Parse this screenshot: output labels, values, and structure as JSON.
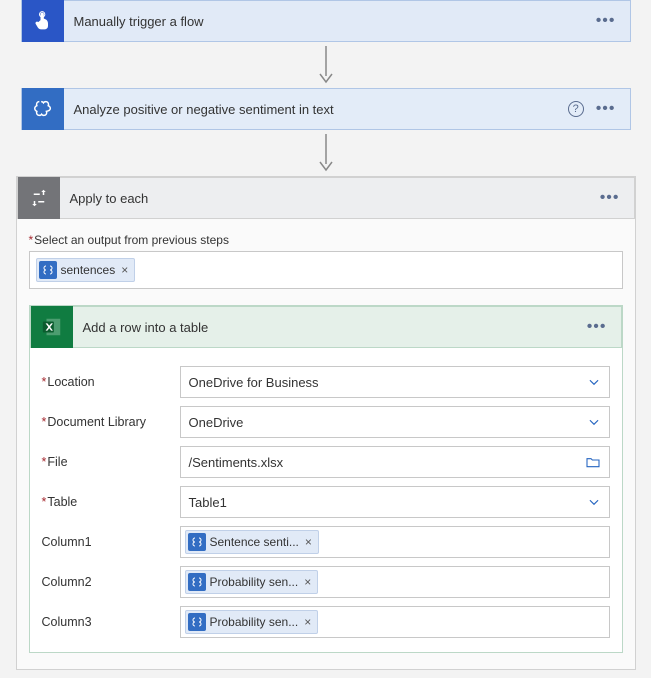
{
  "steps": {
    "trigger": {
      "title": "Manually trigger a flow"
    },
    "sentiment": {
      "title": "Analyze positive or negative sentiment in text"
    },
    "apply": {
      "title": "Apply to each",
      "output_label": "Select an output from previous steps",
      "output_token": "sentences"
    },
    "excel": {
      "title": "Add a row into a table",
      "fields": {
        "location": {
          "label": "Location",
          "value": "OneDrive for Business",
          "required": true,
          "type": "select"
        },
        "doclib": {
          "label": "Document Library",
          "value": "OneDrive",
          "required": true,
          "type": "select"
        },
        "file": {
          "label": "File",
          "value": "/Sentiments.xlsx",
          "required": true,
          "type": "file"
        },
        "table": {
          "label": "Table",
          "value": "Table1",
          "required": true,
          "type": "select"
        },
        "col1": {
          "label": "Column1",
          "token": "Sentence senti...",
          "required": false,
          "type": "token"
        },
        "col2": {
          "label": "Column2",
          "token": "Probability sen...",
          "required": false,
          "type": "token"
        },
        "col3": {
          "label": "Column3",
          "token": "Probability sen...",
          "required": false,
          "type": "token"
        }
      }
    }
  }
}
